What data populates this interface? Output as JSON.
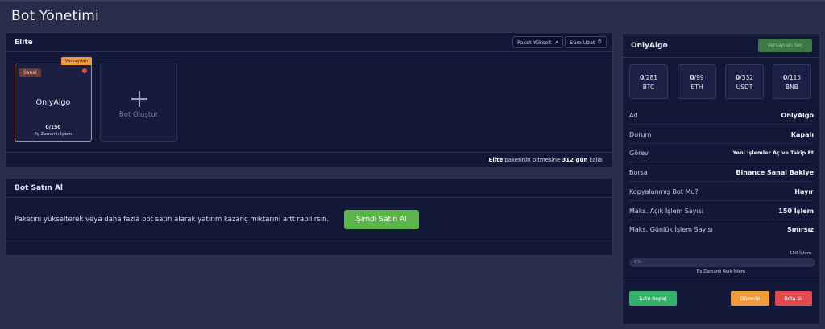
{
  "page": {
    "title": "Bot Yönetimi"
  },
  "elite": {
    "title": "Elite",
    "upgrade_label": "Paket Yükselt",
    "extend_label": "Süre Uzat",
    "bot": {
      "default_tag": "Varsayılan",
      "badge": "Sanal",
      "name": "OnlyAlgo",
      "count": "0/150",
      "subtitle": "Eş Zamanlı İşlem"
    },
    "create_label": "Bot Oluştur",
    "footer": {
      "prefix": "Elite",
      "middle": "paketinin bitmesine",
      "days": "312 gün",
      "suffix": "kaldı"
    }
  },
  "buy": {
    "title": "Bot Satın Al",
    "text": "Paketini yükselterek veya daha fazla bot satın alarak yatırım kazanç miktarını arttırabilirsin.",
    "button_label": "Şimdi Satın Al"
  },
  "detail": {
    "title": "OnlyAlgo",
    "set_default_label": "Varsayılan Seç",
    "coins": [
      {
        "used": "0",
        "total": "/281",
        "name": "BTC"
      },
      {
        "used": "0",
        "total": "/99",
        "name": "ETH"
      },
      {
        "used": "0",
        "total": "/332",
        "name": "USDT"
      },
      {
        "used": "0",
        "total": "/115",
        "name": "BNB"
      }
    ],
    "rows": [
      {
        "label": "Ad",
        "value": "OnlyAlgo"
      },
      {
        "label": "Durum",
        "value": "Kapalı"
      },
      {
        "label": "Görev",
        "value": "Yeni İşlemler Aç ve Takip Et"
      },
      {
        "label": "Borsa",
        "value": "Binance Sanal Bakiye"
      },
      {
        "label": "Kopyalanmış Bot Mu?",
        "value": "Hayır"
      },
      {
        "label": "Maks. Açık İşlem Sayısı",
        "value": "150 İşlem"
      },
      {
        "label": "Maks. Günlük İşlem Sayısı",
        "value": "Sınırsız"
      }
    ],
    "progress": {
      "caption": "150 İşlem",
      "percent_label": "0%",
      "fraction": 0,
      "subtitle": "Eş Zamanlı Açık İşlem"
    },
    "start_label": "Botu Başlat",
    "edit_label": "Düzenle",
    "delete_label": "Botu Sil",
    "colors": {
      "start": "#2fb36b",
      "edit": "#f39a3b",
      "delete": "#e5484d"
    }
  }
}
